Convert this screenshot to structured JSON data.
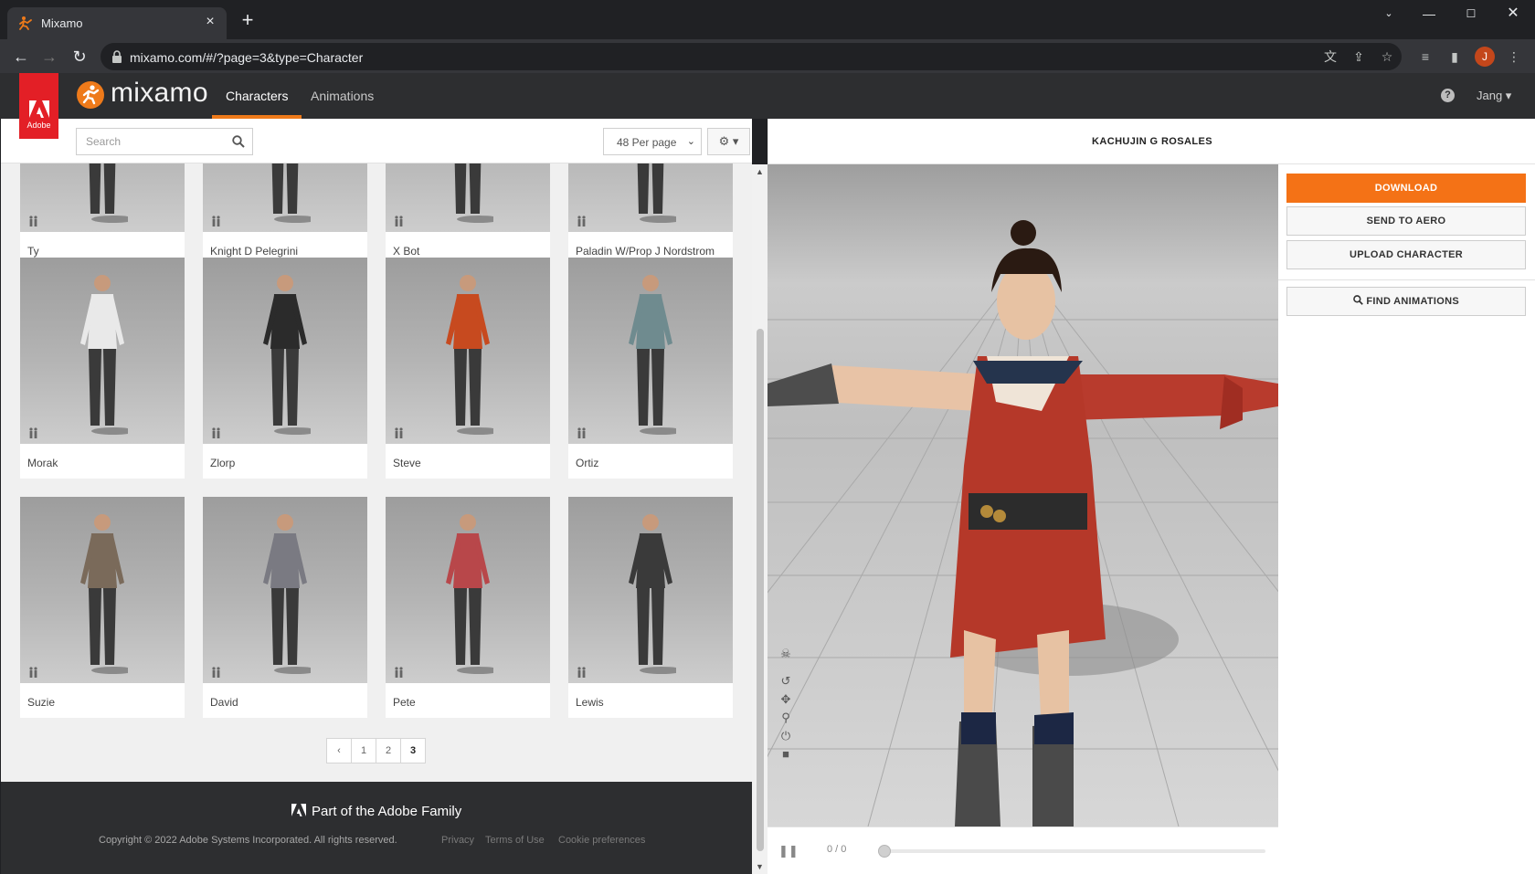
{
  "browser": {
    "tab_title": "Mixamo",
    "tab_close": "×",
    "new_tab": "+",
    "url": "mixamo.com/#/?page=3&type=Character",
    "profile_initial": "J"
  },
  "header": {
    "adobe_label": "Adobe",
    "logo_text": "mixamo",
    "tabs": [
      {
        "label": "Characters",
        "active": true
      },
      {
        "label": "Animations",
        "active": false
      }
    ],
    "help": "?",
    "user_label": "Jang ▾"
  },
  "toolbar": {
    "search_placeholder": "Search",
    "per_page": "48 Per page",
    "gear_label": "⚙ ▾"
  },
  "characters": [
    {
      "name": "Ty"
    },
    {
      "name": "Knight D Pelegrini"
    },
    {
      "name": "X Bot"
    },
    {
      "name": "Paladin W/Prop J Nordstrom"
    },
    {
      "name": "Morak"
    },
    {
      "name": "Zlorp"
    },
    {
      "name": "Steve"
    },
    {
      "name": "Ortiz"
    },
    {
      "name": "Suzie"
    },
    {
      "name": "David"
    },
    {
      "name": "Pete"
    },
    {
      "name": "Lewis"
    }
  ],
  "pagination": {
    "prev": "‹",
    "pages": [
      "1",
      "2",
      "3"
    ],
    "current": "3"
  },
  "footer": {
    "family": "Part of the Adobe Family",
    "copyright": "Copyright © 2022 Adobe Systems Incorporated. All rights reserved.",
    "links": [
      "Privacy",
      "Terms of Use",
      "Cookie preferences"
    ]
  },
  "preview": {
    "character_name": "KACHUJIN G ROSALES",
    "frame_counter": "0 / 0"
  },
  "actions": {
    "download": "DOWNLOAD",
    "send_to_aero": "SEND TO AERO",
    "upload_character": "UPLOAD CHARACTER",
    "find_animations": "FIND ANIMATIONS"
  },
  "colors": {
    "accent": "#f47216",
    "adobe_red": "#e31f26",
    "header_bg": "#2d2e30"
  }
}
